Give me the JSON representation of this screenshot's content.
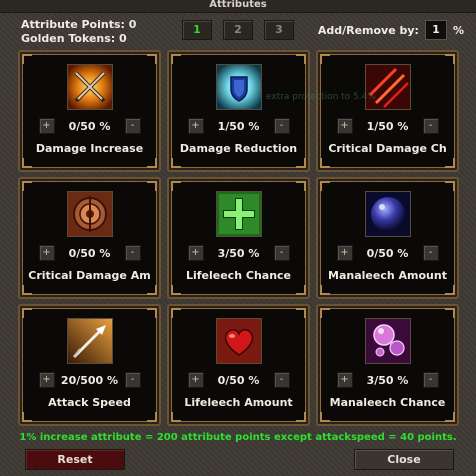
{
  "window": {
    "title": "Attributes"
  },
  "header": {
    "attribute_points_label": "Attribute Points: 0",
    "golden_tokens_label": "Golden Tokens: 0",
    "pages": [
      {
        "label": "1",
        "active": true
      },
      {
        "label": "2",
        "active": false
      },
      {
        "label": "3",
        "active": false
      }
    ],
    "add_remove_label": "Add/Remove by:",
    "add_remove_value": "1",
    "percent_sign": "%"
  },
  "overlay_text": "extra protection to 5.4%",
  "attributes": [
    {
      "name": "Damage Increase",
      "value": "0/50 %",
      "icon": "crossed-swords-icon"
    },
    {
      "name": "Damage Reduction",
      "value": "1/50 %",
      "icon": "shield-icon"
    },
    {
      "name": "Critical Damage Ch",
      "value": "1/50 %",
      "icon": "claw-slash-icon"
    },
    {
      "name": "Critical Damage Am",
      "value": "0/50 %",
      "icon": "target-icon"
    },
    {
      "name": "Lifeleech Chance",
      "value": "3/50 %",
      "icon": "green-cross-icon"
    },
    {
      "name": "Manaleech Amount",
      "value": "0/50 %",
      "icon": "mana-orb-icon"
    },
    {
      "name": "Attack Speed",
      "value": "20/500 %",
      "icon": "arrow-icon"
    },
    {
      "name": "Lifeleech Amount",
      "value": "0/50 %",
      "icon": "heart-icon"
    },
    {
      "name": "Manaleech Chance",
      "value": "3/50 %",
      "icon": "bubbles-icon"
    }
  ],
  "stepper": {
    "plus": "+",
    "minus": "-"
  },
  "footer": {
    "note": "1% increase attribute = 200 attribute points except attackspeed = 40 points.",
    "reset_label": "Reset",
    "close_label": "Close"
  },
  "colors": {
    "accent_green": "#2ee02e",
    "reset_button": "#4a0c0c",
    "card_border": "#8a6a3f"
  }
}
